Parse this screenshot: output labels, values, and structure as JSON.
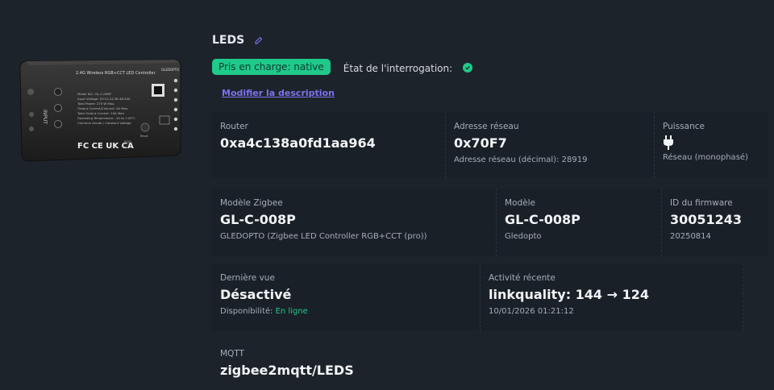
{
  "device": {
    "name": "LEDS",
    "support_badge": "Pris en charge: native",
    "poll_label": "État de l'interrogation:",
    "modify_description": "Modifier la description",
    "image": {
      "header": "2.4G Wireless RGB+CCT LED Controller",
      "brand": "GLEDOPTO",
      "input": "INPUT",
      "specs": [
        "Model NO.: GL-C-008P",
        "Input Voltage: DC12-24-36-48-54V",
        "Total Power: 270 W Max.",
        "Output Current/Channel: 3A Max.",
        "Total Output Current: 10A Max.",
        "Operating Temperature: -20 to +45°C",
        "Common Anode / Constant Voltage"
      ],
      "rating": "IP20",
      "reset": "Reset"
    }
  },
  "info": {
    "router_label": "Router",
    "router_value": "0xa4c138a0fd1aa964",
    "network_label": "Adresse réseau",
    "network_value": "0x70F7",
    "network_decimal": "Adresse réseau (décimal): 28919",
    "power_label": "Puissance",
    "power_value": "Réseau (monophasé)",
    "zigbee_model_label": "Modèle Zigbee",
    "zigbee_model_value": "GL-C-008P",
    "zigbee_model_sub": "GLEDOPTO (Zigbee LED Controller RGB+CCT (pro))",
    "model_label": "Modèle",
    "model_value": "GL-C-008P",
    "model_sub": "Gledopto",
    "firmware_label": "ID du firmware",
    "firmware_value": "30051243",
    "firmware_date": "20250814",
    "last_seen_label": "Dernière vue",
    "last_seen_value": "Désactivé",
    "availability_label": "Disponibilité:",
    "availability_value": "En ligne",
    "activity_label": "Activité récente",
    "activity_value": "linkquality: 144 → 124",
    "activity_time": "10/01/2026 01:21:12",
    "mqtt_label": "MQTT",
    "mqtt_value": "zigbee2mqtt/LEDS"
  },
  "colors": {
    "accent": "#7b74f0",
    "success": "#1fc98c",
    "background": "#1d232a"
  },
  "icons": [
    "edit-icon",
    "check-circle-icon",
    "plug-icon"
  ]
}
